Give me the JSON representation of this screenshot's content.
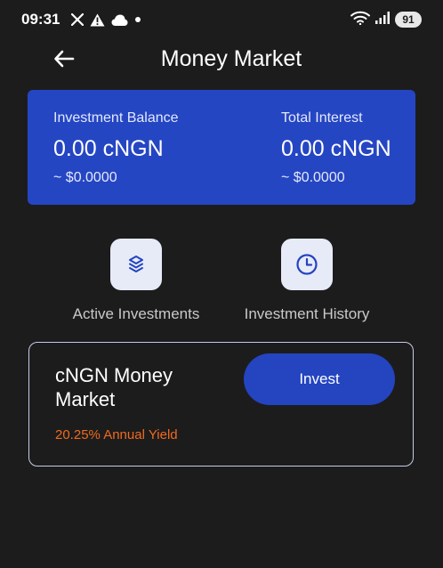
{
  "status_bar": {
    "time": "09:31",
    "battery": "91"
  },
  "header": {
    "title": "Money Market"
  },
  "balance_card": {
    "investment_balance_label": "Investment Balance",
    "investment_balance_value": "0.00 cNGN",
    "investment_balance_usd": "~ $0.0000",
    "total_interest_label": "Total Interest",
    "total_interest_value": "0.00 cNGN",
    "total_interest_usd": "~ $0.0000"
  },
  "quick_actions": {
    "active_investments_label": "Active Investments",
    "investment_history_label": "Investment History"
  },
  "product": {
    "name": "cNGN Money Market",
    "yield": "20.25% Annual Yield",
    "invest_label": "Invest"
  },
  "icons": {
    "status_left": [
      "x-logo-icon",
      "warning-icon",
      "cloud-icon",
      "dot-icon"
    ],
    "status_right": [
      "wifi-icon",
      "signal-icon",
      "battery-icon"
    ],
    "back": "back-arrow-icon",
    "active_investments": "layers-icon",
    "investment_history": "clock-icon"
  },
  "colors": {
    "background": "#1c1c1d",
    "card_blue": "#2546c3",
    "button_blue": "#2444c0",
    "yield_orange": "#f06a1e",
    "tile_bg": "#e7ebf7",
    "icon_blue": "#2444c0"
  }
}
